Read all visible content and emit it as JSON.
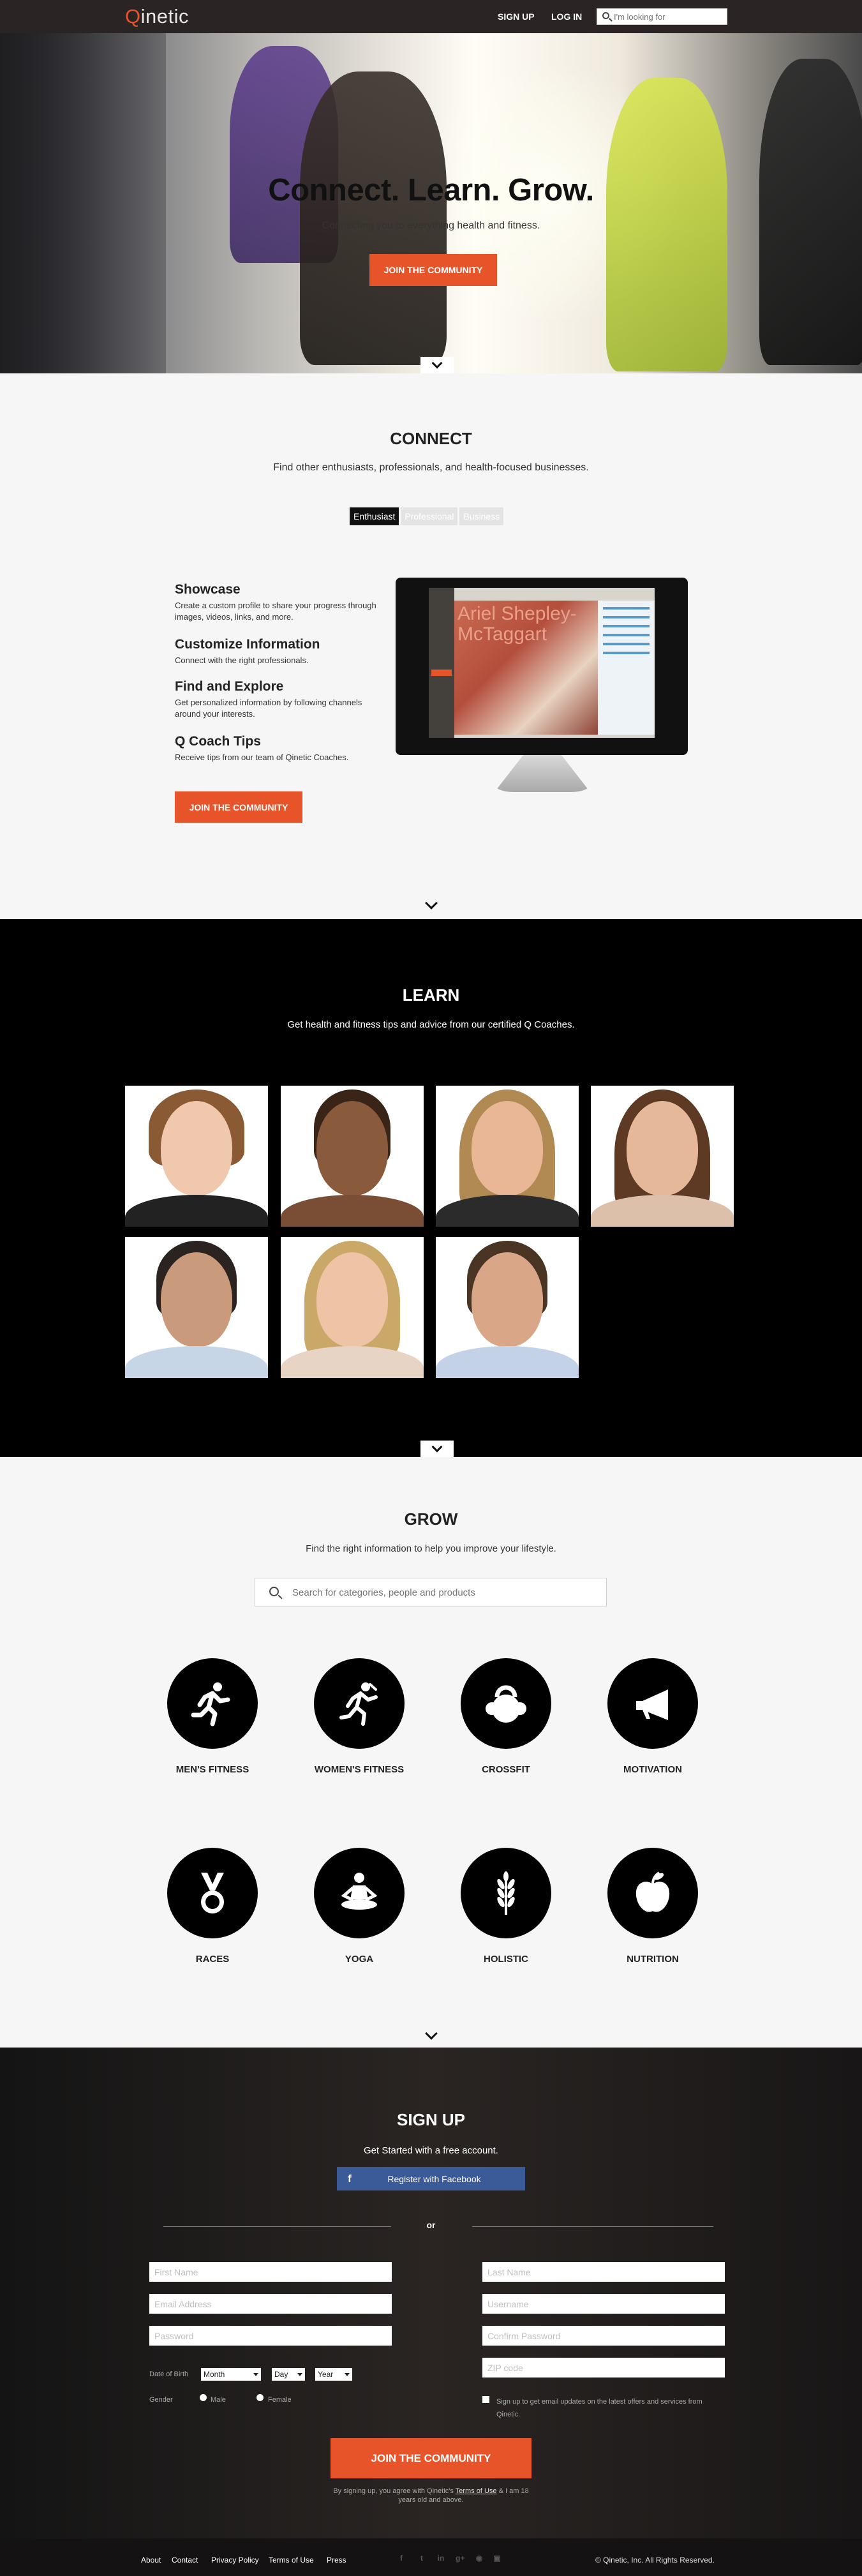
{
  "nav": {
    "logo_q": "Q",
    "logo_rest": "inetic",
    "signup": "SIGN UP",
    "login": "LOG IN",
    "search_placeholder": "I'm looking for"
  },
  "hero": {
    "title": "Connect. Learn. Grow.",
    "subtitle": "Connecting you to everything health and fitness.",
    "cta": "JOIN THE COMMUNITY"
  },
  "connect": {
    "title": "CONNECT",
    "subtitle": "Find other enthusiasts, professionals, and health-focused businesses.",
    "tabs": [
      {
        "label": "Enthusiast",
        "active": true
      },
      {
        "label": "Professional",
        "active": false
      },
      {
        "label": "Business",
        "active": false
      }
    ],
    "features": [
      {
        "title": "Showcase",
        "desc": "Create a custom profile to share your progress through images, videos, links, and more."
      },
      {
        "title": "Customize Information",
        "desc": "Connect with the right professionals."
      },
      {
        "title": "Find and Explore",
        "desc": "Get personalized information by following channels around your interests."
      },
      {
        "title": "Q Coach Tips",
        "desc": "Receive tips from our team of Qinetic Coaches."
      }
    ],
    "screen_name": "Ariel Shepley-McTaggart",
    "cta": "JOIN THE COMMUNITY"
  },
  "learn": {
    "title": "LEARN",
    "subtitle": "Get health and fitness tips and advice from our certified Q Coaches."
  },
  "grow": {
    "title": "GROW",
    "subtitle": "Find the right information to help you improve your lifestyle.",
    "search_placeholder": "Search for categories, people and products",
    "categories": [
      {
        "label": "MEN'S FITNESS",
        "icon": "runner-icon"
      },
      {
        "label": "WOMEN'S FITNESS",
        "icon": "female-runner-icon"
      },
      {
        "label": "CROSSFIT",
        "icon": "kettlebell-icon"
      },
      {
        "label": "MOTIVATION",
        "icon": "megaphone-icon"
      },
      {
        "label": "RACES",
        "icon": "medal-icon"
      },
      {
        "label": "YOGA",
        "icon": "meditation-icon"
      },
      {
        "label": "HOLISTIC",
        "icon": "wheat-icon"
      },
      {
        "label": "NUTRITION",
        "icon": "apple-icon"
      }
    ]
  },
  "signup": {
    "title": "SIGN UP",
    "subtitle": "Get Started with a free account.",
    "facebook": "Register with Facebook",
    "or": "or",
    "first_name": "First Name",
    "last_name": "Last Name",
    "email": "Email Address",
    "username": "Username",
    "password": "Password",
    "confirm_password": "Confirm Password",
    "zip": "ZIP code",
    "dob_label": "Date of Birth",
    "month": "Month",
    "day": "Day",
    "year": "Year",
    "gender_label": "Gender",
    "male": "Male",
    "female": "Female",
    "updates": "Sign up to get email updates on the latest offers and services from Qinetic.",
    "cta": "JOIN THE COMMUNITY",
    "terms_pre": "By signing up, you agree with Qinetic's",
    "terms_link": "Terms of Use",
    "terms_post": "& I am 18 years old and above."
  },
  "footer": {
    "links": [
      "About",
      "Contact",
      "Privacy Policy",
      "Terms of Use",
      "Press"
    ],
    "copyright": "© Qinetic, Inc. All Rights Reserved.",
    "social": [
      "facebook-icon",
      "twitter-icon",
      "linkedin-icon",
      "google-plus-icon",
      "rss-icon",
      "instagram-icon"
    ]
  },
  "colors": {
    "accent": "#e7542a",
    "facebook": "#3b5b98",
    "dark": "#2a2424"
  }
}
